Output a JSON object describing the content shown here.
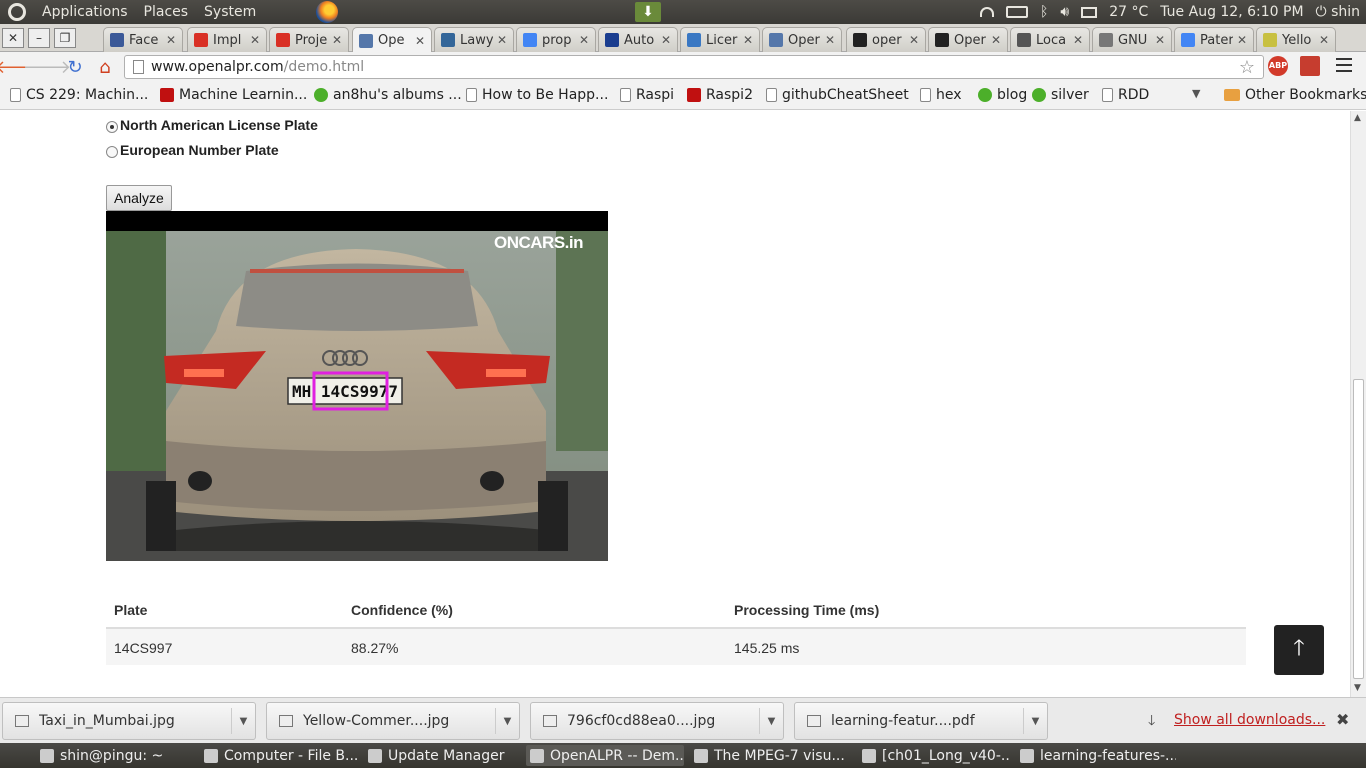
{
  "top_panel": {
    "menus": [
      "Applications",
      "Places",
      "System"
    ],
    "weather": "27 °C",
    "datetime": "Tue Aug 12,  6:10 PM",
    "user": "shin"
  },
  "tabs": [
    {
      "label": "Face",
      "icon": "facebook-icon",
      "color": "#3b5998"
    },
    {
      "label": "Impl",
      "icon": "gmail-icon",
      "color": "#d93025"
    },
    {
      "label": "Proje",
      "icon": "gmail-icon",
      "color": "#d93025"
    },
    {
      "label": "Ope",
      "icon": "page-icon",
      "color": "#5577aa",
      "active": true
    },
    {
      "label": "Lawy",
      "icon": "reddit-icon",
      "color": "#336699"
    },
    {
      "label": "prop",
      "icon": "google-icon",
      "color": "#4285f4"
    },
    {
      "label": "Auto",
      "icon": "nec-icon",
      "color": "#1a3d8f"
    },
    {
      "label": "Licer",
      "icon": "k-icon",
      "color": "#3a78c3"
    },
    {
      "label": "Oper",
      "icon": "page-icon",
      "color": "#5577aa"
    },
    {
      "label": "oper",
      "icon": "github-icon",
      "color": "#222222"
    },
    {
      "label": "Oper",
      "icon": "github-icon",
      "color": "#222222"
    },
    {
      "label": "Loca",
      "icon": "wikipedia-icon",
      "color": "#555555"
    },
    {
      "label": "GNU",
      "icon": "gnu-icon",
      "color": "#777777"
    },
    {
      "label": "Pater",
      "icon": "google-icon",
      "color": "#4285f4"
    },
    {
      "label": "Yello",
      "icon": "circle-icon",
      "color": "#c8c040"
    }
  ],
  "toolbar": {
    "url_host": "www.openalpr.com",
    "url_path": "/demo.html",
    "abp_label": "ABP"
  },
  "bookmarks": [
    {
      "label": "CS 229: Machin...",
      "icon": "doc"
    },
    {
      "label": "Machine Learnin...",
      "icon": "red"
    },
    {
      "label": "an8hu's albums ...",
      "icon": "green"
    },
    {
      "label": "How to Be Happ...",
      "icon": "doc"
    },
    {
      "label": "Raspi",
      "icon": "doc"
    },
    {
      "label": "Raspi2",
      "icon": "red"
    },
    {
      "label": "githubCheatSheet",
      "icon": "doc"
    },
    {
      "label": "hex",
      "icon": "doc"
    },
    {
      "label": "blog",
      "icon": "green"
    },
    {
      "label": "silver",
      "icon": "green"
    },
    {
      "label": "RDD",
      "icon": "doc"
    }
  ],
  "other_bookmarks": "Other Bookmarks",
  "form": {
    "option_na": "North American License Plate",
    "option_eu": "European Number Plate",
    "selected": "north-american",
    "analyze_label": "Analyze"
  },
  "photo": {
    "watermark": "ONCARS.in",
    "plate_text": "MH 14CS9977"
  },
  "results": {
    "headers": [
      "Plate",
      "Confidence (%)",
      "Processing Time (ms)"
    ],
    "rows": [
      [
        "14CS997",
        "88.27%",
        "145.25 ms"
      ]
    ]
  },
  "downloads": {
    "items": [
      "Taxi_in_Mumbai.jpg",
      "Yellow-Commer....jpg",
      "796cf0cd88ea0....jpg",
      "learning-featur....pdf"
    ],
    "show_all": "Show all downloads..."
  },
  "taskbar": [
    {
      "label": "shin@pingu: ~"
    },
    {
      "label": "Computer - File B..."
    },
    {
      "label": "Update Manager"
    },
    {
      "label": "OpenALPR -- Dem...",
      "active": true
    },
    {
      "label": "The MPEG-7 visu..."
    },
    {
      "label": "[ch01_Long_v40-..."
    },
    {
      "label": "learning-features-..."
    }
  ],
  "colors": {
    "highlight_box": "#e020e0",
    "link_red": "#c02020"
  }
}
